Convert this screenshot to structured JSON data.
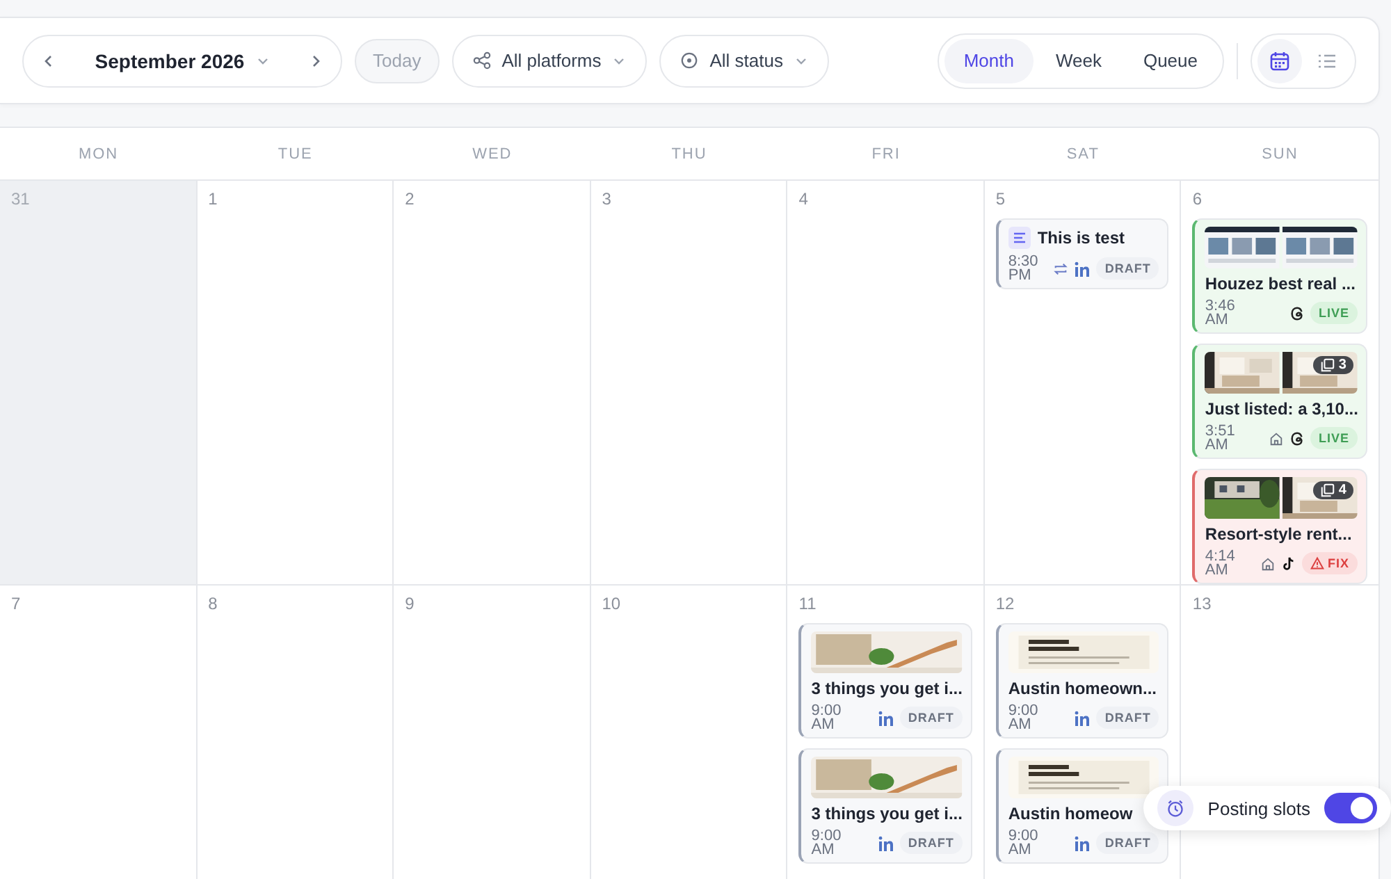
{
  "toolbar": {
    "month": "September 2026",
    "today": "Today",
    "platforms": "All platforms",
    "status": "All status",
    "views": [
      {
        "label": "Month",
        "selected": true
      },
      {
        "label": "Week",
        "selected": false
      },
      {
        "label": "Queue",
        "selected": false
      }
    ],
    "layouts": [
      {
        "kind": "calendar",
        "selected": true
      },
      {
        "kind": "list",
        "selected": false
      }
    ]
  },
  "weekdays": [
    "MON",
    "TUE",
    "WED",
    "THU",
    "FRI",
    "SAT",
    "SUN"
  ],
  "weeks": [
    {
      "days": [
        {
          "number": "31",
          "muted": true
        },
        {
          "number": "1",
          "muted": false
        },
        {
          "number": "2",
          "muted": false
        },
        {
          "number": "3",
          "muted": false
        },
        {
          "number": "4",
          "muted": false
        },
        {
          "number": "5",
          "muted": false,
          "posts": [
            {
              "kind": "text",
              "title": "This is test",
              "time": "8:30 PM",
              "platforms": [
                {
                  "kind": "repost"
                },
                {
                  "kind": "in"
                }
              ],
              "status": {
                "kind": "draft",
                "label": "DRAFT"
              }
            }
          ]
        },
        {
          "number": "6",
          "muted": false,
          "posts": [
            {
              "thumbs": [
                {
                  "kind": "picture"
                },
                {
                  "kind": "picture"
                }
              ],
              "title": "Houzez best real ...",
              "time": "3:46 AM",
              "platforms": [
                {
                  "kind": "threads"
                }
              ],
              "status": {
                "kind": "live",
                "label": "LIVE"
              }
            },
            {
              "thumbs": [
                {
                  "kind": "picture"
                },
                {
                  "kind": "picture"
                }
              ],
              "count": "3",
              "title": "Just listed: a 3,10...",
              "time": "3:51 AM",
              "platforms": [
                {
                  "kind": "home"
                },
                {
                  "kind": "threads"
                }
              ],
              "status": {
                "kind": "live",
                "label": "LIVE"
              }
            },
            {
              "thumbs": [
                {
                  "kind": "picture"
                },
                {
                  "kind": "picture"
                }
              ],
              "count": "4",
              "title": "Resort-style rent...",
              "time": "4:14 AM",
              "platforms": [
                {
                  "kind": "home"
                },
                {
                  "kind": "tiktok"
                }
              ],
              "status": {
                "kind": "fix",
                "label": "FIX"
              }
            }
          ]
        }
      ]
    },
    {
      "days": [
        {
          "number": "7",
          "muted": false
        },
        {
          "number": "8",
          "muted": false
        },
        {
          "number": "9",
          "muted": false
        },
        {
          "number": "10",
          "muted": false
        },
        {
          "number": "11",
          "muted": false,
          "posts": [
            {
              "thumbs": [
                {
                  "kind": "picture"
                }
              ],
              "title": "3 things you get i...",
              "time": "9:00 AM",
              "platforms": [
                {
                  "kind": "in"
                }
              ],
              "status": {
                "kind": "draft",
                "label": "DRAFT"
              }
            },
            {
              "thumbs": [
                {
                  "kind": "picture"
                }
              ],
              "title": "3 things you get i...",
              "time": "9:00 AM",
              "platforms": [
                {
                  "kind": "in"
                }
              ],
              "status": {
                "kind": "draft",
                "label": "DRAFT"
              }
            }
          ]
        },
        {
          "number": "12",
          "muted": false,
          "posts": [
            {
              "thumbs": [
                {
                  "kind": "picture"
                }
              ],
              "title": "Austin homeown...",
              "time": "9:00 AM",
              "platforms": [
                {
                  "kind": "in"
                }
              ],
              "status": {
                "kind": "draft",
                "label": "DRAFT"
              }
            },
            {
              "thumbs": [
                {
                  "kind": "picture"
                }
              ],
              "title": "Austin homeow",
              "time": "9:00 AM",
              "platforms": [
                {
                  "kind": "in"
                }
              ],
              "status": {
                "kind": "draft",
                "label": "DRAFT"
              }
            }
          ]
        },
        {
          "number": "13",
          "muted": false
        }
      ]
    }
  ],
  "posting_slots": {
    "label": "Posting slots",
    "on": true
  }
}
